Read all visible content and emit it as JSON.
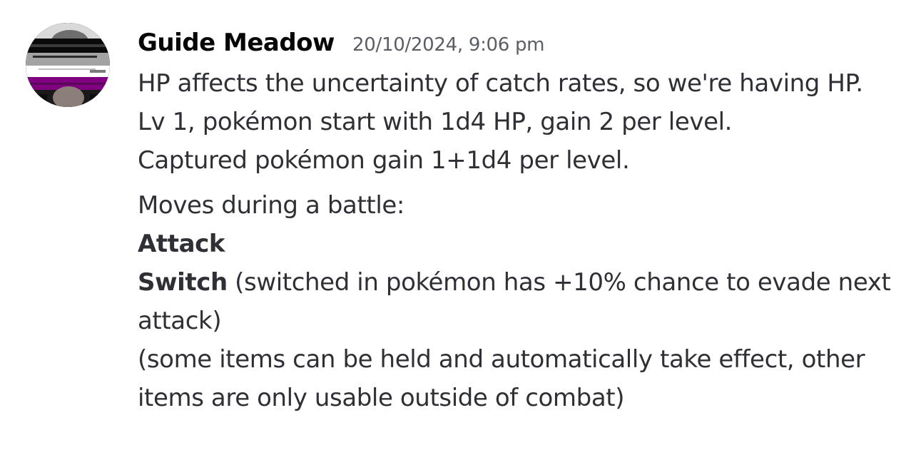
{
  "author": {
    "name": "Guide Meadow",
    "timestamp": "20/10/2024, 9:06 pm",
    "avatar_icon": "user-avatar-asexual-flag-overlay",
    "avatar_colors": [
      "#000000",
      "#a3a3a3",
      "#ffffff",
      "#800080"
    ]
  },
  "message": {
    "line1": "HP affects the uncertainty of catch rates, so we're having HP.",
    "line2": "Lv 1, pokémon start with 1d4 HP, gain 2 per level.",
    "line3": "Captured pokémon gain 1+1d4 per level.",
    "moves_heading": "Moves during a battle:",
    "attack_label": "Attack",
    "switch_label": "Switch",
    "switch_note": " (switched in pokémon has +10% chance to evade next attack)",
    "items_note": "(some items can be held and automatically take effect, other items are only usable outside of combat)"
  }
}
